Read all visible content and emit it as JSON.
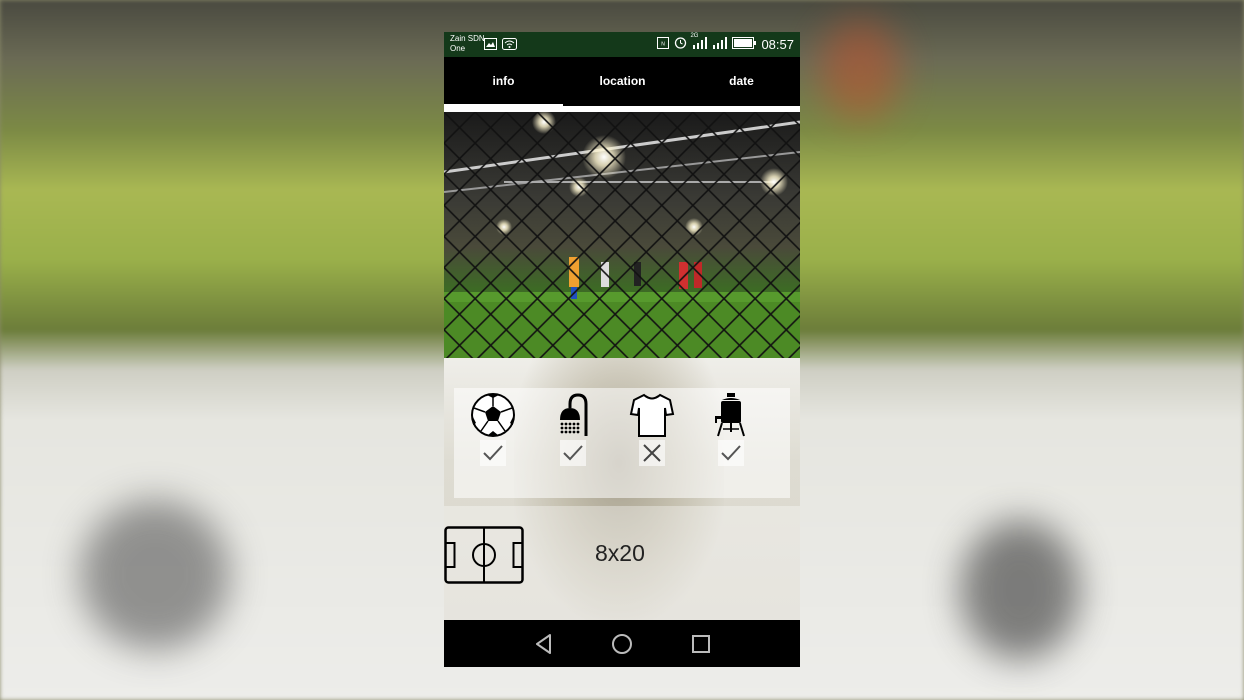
{
  "status_bar": {
    "carrier_line1": "Zain SDN",
    "carrier_line2": "One",
    "network_type": "2G",
    "time": "08:57",
    "icons": [
      "image-icon",
      "wifi-icon",
      "nfc-icon",
      "alarm-icon",
      "signal-icon",
      "signal-icon",
      "battery-icon"
    ]
  },
  "tabs": [
    {
      "label": "info",
      "selected": true
    },
    {
      "label": "location",
      "selected": false
    },
    {
      "label": "date",
      "selected": false
    }
  ],
  "amenities": [
    {
      "icon": "soccer-ball-icon",
      "available": true
    },
    {
      "icon": "shower-icon",
      "available": true
    },
    {
      "icon": "jersey-icon",
      "available": false
    },
    {
      "icon": "water-cooler-icon",
      "available": true
    }
  ],
  "field": {
    "icon": "football-field-icon",
    "size": "8x20"
  },
  "nav": {
    "icons": [
      "back-icon",
      "home-icon",
      "recents-icon"
    ]
  },
  "colors": {
    "status_bar": "#14391a",
    "tab_bar": "#000000",
    "nav_bar": "#000000"
  }
}
